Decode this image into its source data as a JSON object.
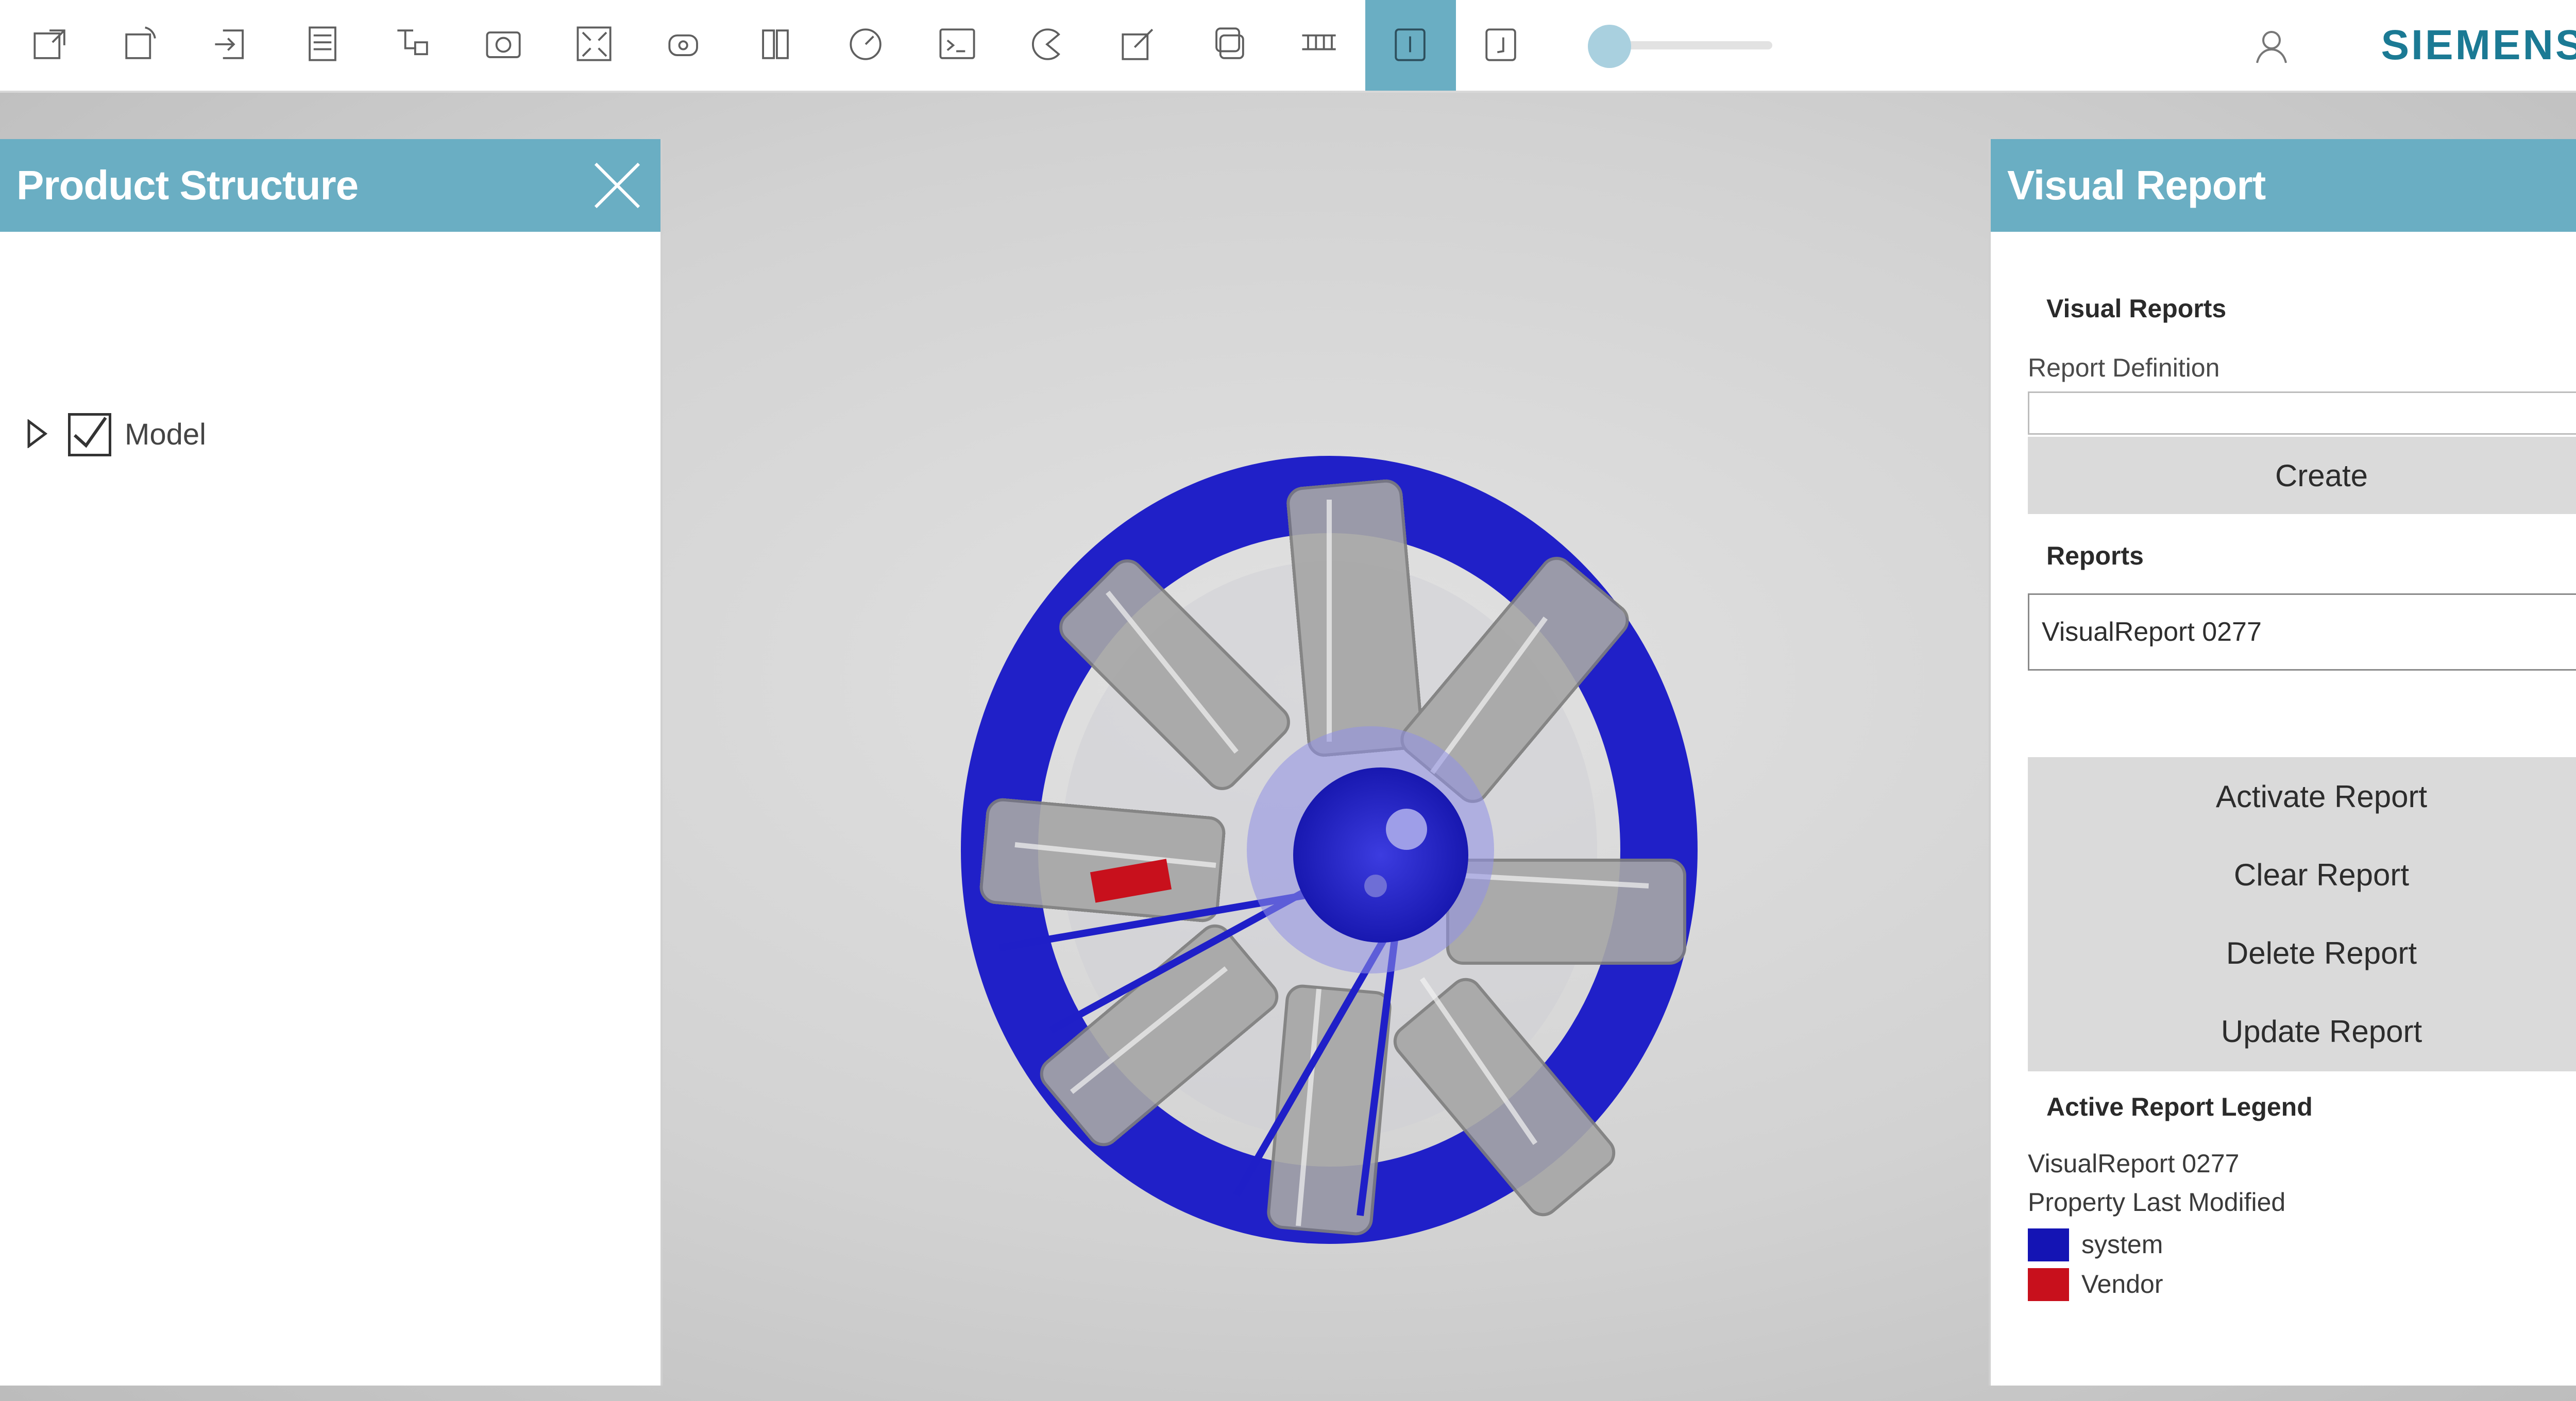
{
  "toolbar": {
    "buttons": [
      {
        "icon": "export-icon"
      },
      {
        "icon": "rotate-icon"
      },
      {
        "icon": "import-icon"
      },
      {
        "icon": "list-view-icon"
      },
      {
        "icon": "structure-icon"
      },
      {
        "icon": "camera-icon"
      },
      {
        "icon": "fit-all-icon"
      },
      {
        "icon": "annotation-icon"
      },
      {
        "icon": "section-icon"
      },
      {
        "icon": "measure-icon"
      },
      {
        "icon": "command-icon"
      },
      {
        "icon": "pie-icon"
      },
      {
        "icon": "edit-icon"
      },
      {
        "icon": "layers-icon"
      },
      {
        "icon": "grid-icon"
      },
      {
        "icon": "visual-report-icon",
        "active": true
      },
      {
        "icon": "notes-icon"
      }
    ],
    "brand": "SIEMENS",
    "accent_color": "#6aaec3"
  },
  "product_structure": {
    "title": "Product Structure",
    "tree": [
      {
        "label": "Model",
        "checked": true,
        "expanded": false
      }
    ]
  },
  "visual_report": {
    "title": "Visual Report",
    "section_title": "Visual Reports",
    "definition_label": "Report Definition",
    "definition_value": "",
    "create_label": "Create",
    "reports_title": "Reports",
    "selected_report": "VisualReport 0277",
    "actions": [
      "Activate Report",
      "Clear Report",
      "Delete Report",
      "Update Report"
    ],
    "legend_title": "Active Report Legend",
    "legend_name": "VisualReport 0277",
    "legend_property": "Property Last Modified",
    "legend_items": [
      {
        "label": "system",
        "color": "#1414b4"
      },
      {
        "label": "Vendor",
        "color": "#c8101c"
      }
    ]
  }
}
